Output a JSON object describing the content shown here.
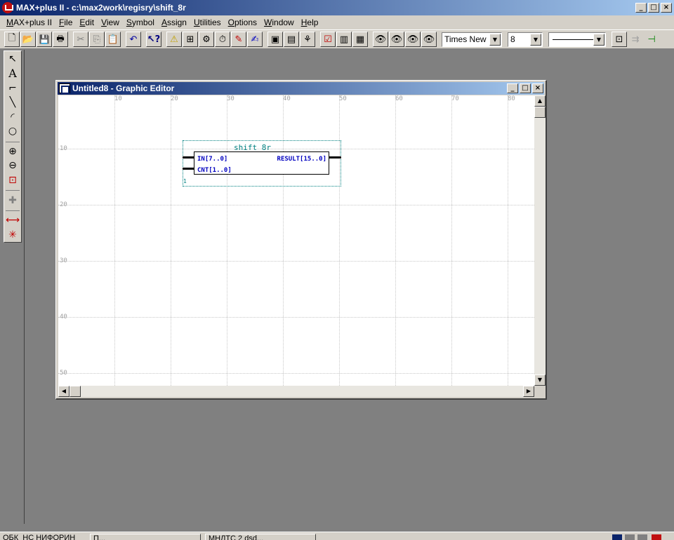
{
  "app": {
    "title": "MAX+plus II - c:\\max2work\\regisry\\shift_8r",
    "window_buttons": [
      "_",
      "□",
      "×"
    ]
  },
  "menu": [
    "MAX+plus II",
    "File",
    "Edit",
    "View",
    "Symbol",
    "Assign",
    "Utilities",
    "Options",
    "Window",
    "Help"
  ],
  "toolbar": {
    "font_name": "Times New",
    "font_size": "8",
    "combo_arrow": "▼"
  },
  "editor": {
    "title": "Untitled8 - Graphic Editor",
    "ruler_x": [
      "10",
      "20",
      "30",
      "40",
      "50",
      "60",
      "70",
      "80"
    ],
    "ruler_y": [
      "10",
      "20",
      "30",
      "40",
      "50"
    ]
  },
  "symbol": {
    "name": "shift_8r",
    "inputs": [
      "IN[7..0]",
      "CNT[1..0]"
    ],
    "outputs": [
      "RESULT[15..0]"
    ],
    "number": "1"
  },
  "taskbar": {
    "items": [
      "ОБК_НС НИФОРИН",
      "П...",
      "МНЛТС 2 dsd..."
    ]
  },
  "colors": {
    "title_active": "#0a246a",
    "symbol_frame": "#008080",
    "port_text": "#0000c0"
  }
}
